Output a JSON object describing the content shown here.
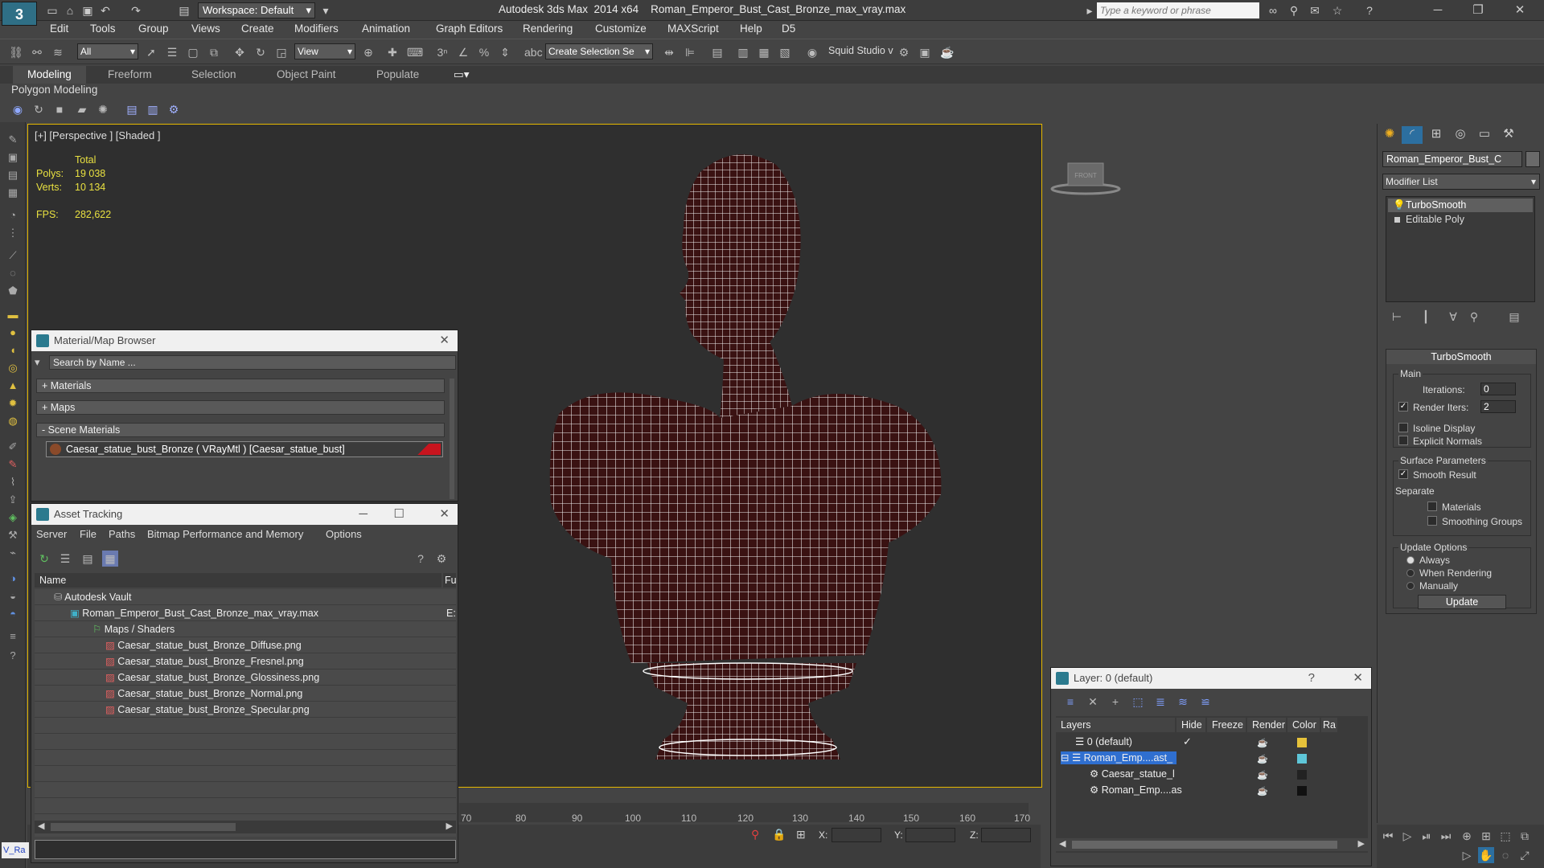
{
  "title_bar": {
    "app_title": "Autodesk 3ds Max  2014 x64    Roman_Emperor_Bust_Cast_Bronze_max_vray.max",
    "workspace": "Workspace: Default",
    "search_placeholder": "Type a keyword or phrase",
    "logo": "3"
  },
  "menu": [
    "Edit",
    "Tools",
    "Group",
    "Views",
    "Create",
    "Modifiers",
    "Animation",
    "Graph Editors",
    "Rendering",
    "Customize",
    "MAXScript",
    "Help",
    "D5"
  ],
  "toolbar": {
    "selection_filter": "All",
    "ref_coord": "View",
    "selection_set": "Create Selection Se",
    "squid_label": "Squid Studio v"
  },
  "ribbon": {
    "tabs": [
      "Modeling",
      "Freeform",
      "Selection",
      "Object Paint",
      "Populate"
    ],
    "active": "Modeling",
    "panel_label": "Polygon Modeling"
  },
  "viewport": {
    "label": "[+] [Perspective ] [Shaded ]",
    "stats": {
      "total_label": "Total",
      "polys_label": "Polys:",
      "polys": "19 038",
      "verts_label": "Verts:",
      "verts": "10 134",
      "fps_label": "FPS:",
      "fps": "282,622"
    }
  },
  "timeline": {
    "ticks": [
      "70",
      "80",
      "90",
      "100",
      "110",
      "120",
      "130",
      "140",
      "150",
      "160",
      "170"
    ]
  },
  "status": {
    "x_label": "X:",
    "y_label": "Y:",
    "z_label": "Z:",
    "maxscript": "V_Ra"
  },
  "material_browser": {
    "title": "Material/Map Browser",
    "search": "Search by Name ...",
    "sections": [
      "+ Materials",
      "+ Maps",
      "- Scene Materials"
    ],
    "material": "Caesar_statue_bust_Bronze ( VRayMtl ) [Caesar_statue_bust]",
    "accent": "#c8141e"
  },
  "asset_tracking": {
    "title": "Asset Tracking",
    "menu": [
      "Server",
      "File",
      "Paths",
      "Bitmap Performance and Memory",
      "Options"
    ],
    "col_name": "Name",
    "col_full": "Fu",
    "rows": [
      {
        "name": "Autodesk Vault",
        "status": ""
      },
      {
        "name": "Roman_Emperor_Bust_Cast_Bronze_max_vray.max",
        "status": "E:"
      },
      {
        "name": "Maps / Shaders",
        "status": ""
      },
      {
        "name": "Caesar_statue_bust_Bronze_Diffuse.png",
        "status": ""
      },
      {
        "name": "Caesar_statue_bust_Bronze_Fresnel.png",
        "status": ""
      },
      {
        "name": "Caesar_statue_bust_Bronze_Glossiness.png",
        "status": ""
      },
      {
        "name": "Caesar_statue_bust_Bronze_Normal.png",
        "status": ""
      },
      {
        "name": "Caesar_statue_bust_Bronze_Specular.png",
        "status": ""
      }
    ]
  },
  "layers": {
    "title": "Layer: 0 (default)",
    "cols": [
      "Layers",
      "Hide",
      "Freeze",
      "Render",
      "Color",
      "Ra"
    ],
    "rows": [
      {
        "name": "0 (default)",
        "color": "#e6c23a"
      },
      {
        "name": "Roman_Emp....ast_",
        "color": "#5ec6d8"
      },
      {
        "name": "Caesar_statue_l",
        "color": "#222222"
      },
      {
        "name": "Roman_Emp....as",
        "color": "#111111"
      }
    ]
  },
  "command_panel": {
    "object_name": "Roman_Emperor_Bust_C",
    "modifier_list": "Modifier List",
    "stack": [
      "TurboSmooth",
      "Editable Poly"
    ],
    "turbosmooth": {
      "title": "TurboSmooth",
      "main": "Main",
      "iterations_label": "Iterations:",
      "iterations": "0",
      "render_iters_label": "Render Iters:",
      "render_iters": "2",
      "isoline": "Isoline Display",
      "explicit": "Explicit Normals",
      "surface": "Surface Parameters",
      "smooth": "Smooth Result",
      "separate": "Separate",
      "materials": "Materials",
      "smoothing_groups": "Smoothing Groups",
      "update_options": "Update Options",
      "always": "Always",
      "when_rendering": "When Rendering",
      "manually": "Manually",
      "update": "Update"
    }
  }
}
